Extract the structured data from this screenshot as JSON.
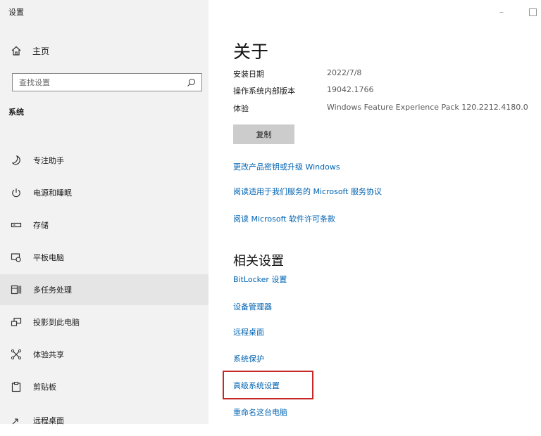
{
  "window": {
    "title": "设置"
  },
  "sidebar": {
    "home_label": "主页",
    "search_placeholder": "查找设置",
    "section_title": "系统",
    "items": [
      {
        "label": "专注助手",
        "icon": "moon-icon"
      },
      {
        "label": "电源和睡眠",
        "icon": "power-icon"
      },
      {
        "label": "存储",
        "icon": "storage-icon"
      },
      {
        "label": "平板电脑",
        "icon": "tablet-icon"
      },
      {
        "label": "多任务处理",
        "icon": "multitasking-icon",
        "selected": true
      },
      {
        "label": "投影到此电脑",
        "icon": "projector-icon"
      },
      {
        "label": "体验共享",
        "icon": "share-icon"
      },
      {
        "label": "剪贴板",
        "icon": "clipboard-icon"
      },
      {
        "label": "远程桌面",
        "icon": "remote-desktop-icon"
      }
    ]
  },
  "main": {
    "title": "关于",
    "specs": [
      {
        "key": "安装日期",
        "value": "2022/7/8"
      },
      {
        "key": "操作系统内部版本",
        "value": "19042.1766"
      },
      {
        "key": "体验",
        "value": "Windows Feature Experience Pack 120.2212.4180.0"
      }
    ],
    "copy_label": "复制",
    "links": [
      "更改产品密钥或升级 Windows",
      "阅读适用于我们服务的 Microsoft 服务协议",
      "阅读 Microsoft 软件许可条款"
    ],
    "related_title": "相关设置",
    "related_links": [
      "BitLocker 设置",
      "设备管理器",
      "远程桌面",
      "系统保护",
      "高级系统设置",
      "重命名这台电脑"
    ],
    "highlighted_link": "高级系统设置"
  },
  "colors": {
    "sidebar_bg": "#f2f2f2",
    "selected_bg": "#e5e5e5",
    "link": "#0063b1",
    "highlight_border": "#c62828"
  }
}
